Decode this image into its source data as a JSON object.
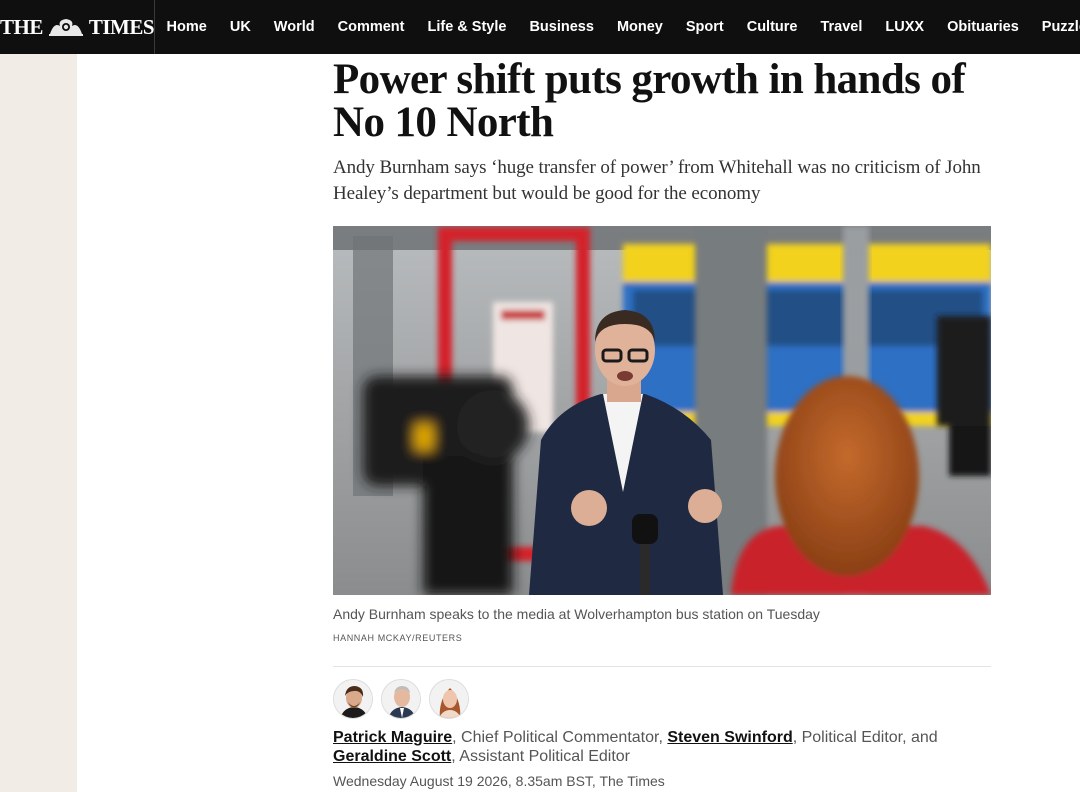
{
  "brand": {
    "logo_left": "THE",
    "logo_right": "TIMES"
  },
  "nav": [
    "Home",
    "UK",
    "World",
    "Comment",
    "Life & Style",
    "Business",
    "Money",
    "Sport",
    "Culture",
    "Travel",
    "LUXX",
    "Obituaries",
    "Puzzles"
  ],
  "article": {
    "headline": "Power shift puts growth in hands of No 10 North",
    "standfirst": "Andy Burnham says ‘huge transfer of power’ from Whitehall was no criticism of John Healey’s department but would be good for the economy",
    "image": {
      "caption": "Andy Burnham speaks to the media at Wolverhampton bus station on Tuesday",
      "credit": "HANNAH MCKAY/REUTERS"
    },
    "authors": [
      {
        "name": "Patrick Maguire",
        "role": "Chief Political Commentator"
      },
      {
        "name": "Steven Swinford",
        "role": "Political Editor"
      },
      {
        "name": "Geraldine Scott",
        "role": "Assistant Political Editor"
      }
    ],
    "byline_sep_1": ", ",
    "byline_sep_2": ", ",
    "byline_and": ", and ",
    "byline_sep_3": ", ",
    "dateline": "Wednesday August 19 2026, 8.35am BST, The Times"
  },
  "colors": {
    "nav_bg": "#0f0f0f",
    "gutter": "#f1ede6",
    "bus_yellow": "#f2d21a",
    "bus_blue": "#2f6fc4",
    "frame_red": "#d4232a"
  }
}
